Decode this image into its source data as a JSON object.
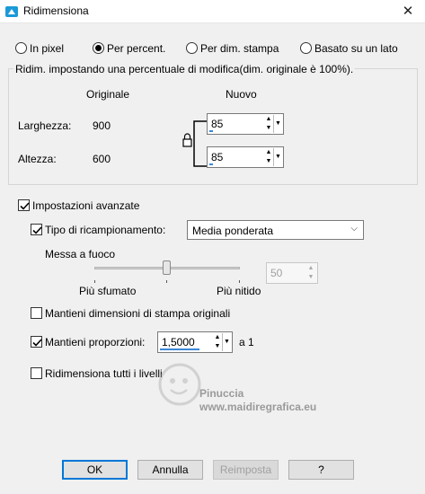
{
  "window": {
    "title": "Ridimensiona",
    "close_glyph": "✕"
  },
  "mode_radios": [
    {
      "label": "In pixel",
      "selected": false
    },
    {
      "label": "Per percent.",
      "selected": true
    },
    {
      "label": "Per dim. stampa",
      "selected": false
    },
    {
      "label": "Basato su un lato",
      "selected": false
    }
  ],
  "group": {
    "legend": "Ridim. impostando una percentuale di modifica(dim. originale è 100%).",
    "col_original": "Originale",
    "col_new": "Nuovo",
    "width_label": "Larghezza:",
    "width_original": "900",
    "width_new": "85",
    "height_label": "Altezza:",
    "height_original": "600",
    "height_new": "85",
    "lock_icon": "lock-icon"
  },
  "advanced": {
    "label": "Impostazioni avanzate",
    "checked": true,
    "resample_label": "Tipo di ricampionamento:",
    "resample_checked": true,
    "resample_value": "Media ponderata",
    "sharpen_label": "Messa a fuoco",
    "slider_min_label": "Più sfumato",
    "slider_max_label": "Più nitido",
    "slider_level": 50,
    "sharpen_value": "50",
    "keep_print_label": "Mantieni dimensioni di stampa originali",
    "keep_print_checked": false,
    "keep_ratio_label": "Mantieni proporzioni:",
    "keep_ratio_checked": true,
    "ratio_value": "1,5000",
    "ratio_suffix": "a 1",
    "all_layers_label": "Ridimensiona tutti i livelli",
    "all_layers_checked": false
  },
  "watermark": {
    "line1": "Pinuccia",
    "line2": "www.maidiregrafica.eu"
  },
  "buttons": {
    "ok": "OK",
    "cancel": "Annulla",
    "reset": "Reimposta",
    "help": "?"
  },
  "colors": {
    "accent": "#0078d7",
    "app_icon": "#1a9ad6"
  }
}
